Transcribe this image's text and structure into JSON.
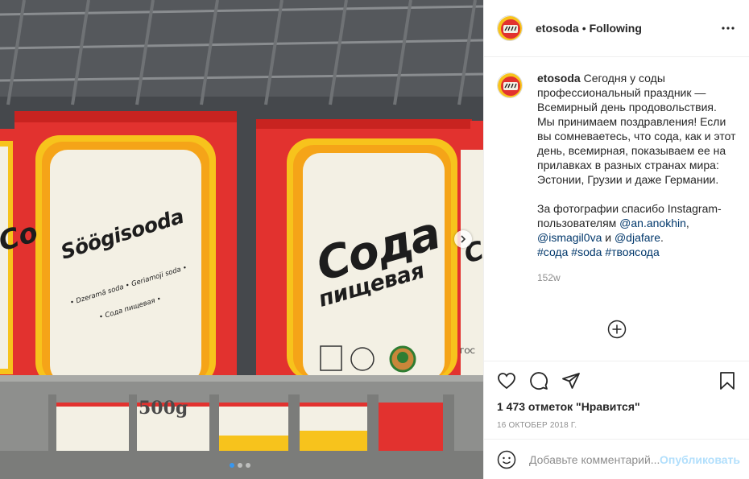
{
  "photo": {
    "label_left_box": "Söögisooda",
    "label_left_sub1": "• Dzeramā soda • Geriamoji soda •",
    "label_left_sub2": "• Сода пищевая •",
    "label_right_big": "Сода",
    "label_right_small": "пищевая",
    "label_left_cut": "Со",
    "label_right_cut": "Co",
    "weight": "500g",
    "gost": "ГОС",
    "slide_count": 3,
    "active_slide": 1,
    "next_icon": "chevron-right-icon"
  },
  "header": {
    "username": "etosoda",
    "separator": "•",
    "follow_status": "Following",
    "more_icon": "more-horizontal-icon"
  },
  "caption": {
    "username": "etosoda",
    "text1": "Сегодня у соды профессиональный праздник — Всемирный день продовольствия. Мы принимаем поздравления! Если вы сомневаетесь, что сода, как и этот день, всемирная, показываем ее на прилавках в разных странах мира: Эстонии, Грузии и даже Германии.",
    "text2_prefix": "За фотографии спасибо Instagram-пользователям ",
    "mention1": "@an.anokhin",
    "sep1": ",",
    "mention2": "@ismagil0va",
    "and": " и ",
    "mention3": "@djafare",
    "dot": ".",
    "hashtag1": "#сода",
    "hashtag2": "#soda",
    "hashtag3": "#твоясода",
    "time_ago": "152w"
  },
  "load_more_icon": "plus-circle-icon",
  "actions": {
    "like_icon": "heart-icon",
    "comment_icon": "comment-icon",
    "share_icon": "paper-plane-icon",
    "save_icon": "bookmark-icon",
    "likes_text": "1 473 отметок \"Нравится\"",
    "date": "16 октобер 2018 г."
  },
  "add_comment": {
    "emoji_icon": "smiley-icon",
    "placeholder": "Добавьте комментарий...",
    "post_label": "Опубликовать"
  },
  "colors": {
    "box_red": "#e2322f",
    "box_yellow": "#f7c31c",
    "link": "#00376b",
    "post_disabled": "#b2dffc",
    "accent_dot": "#3897f0"
  }
}
